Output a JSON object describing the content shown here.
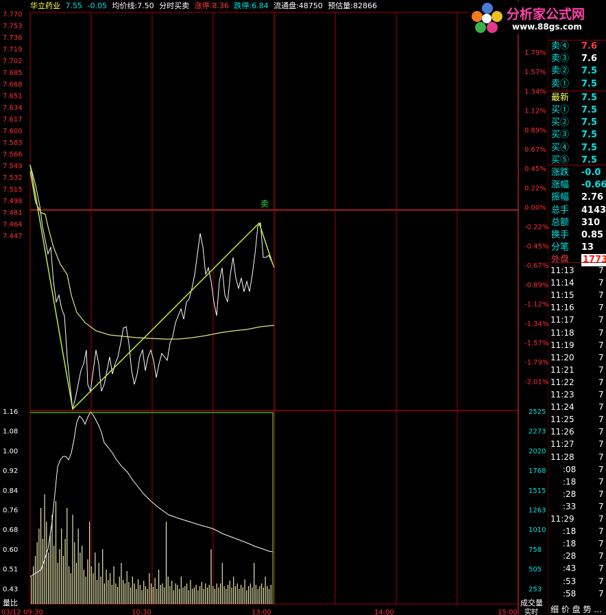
{
  "header": {
    "stock_name": "华立药业",
    "price": "7.55",
    "change": "-0.05",
    "avg_label": "均价线:7.50",
    "chart_mode": "分时买卖",
    "limit_up": "涨停:8.36",
    "limit_down": "跌停:6.84",
    "float_shares": "流通盘:48750",
    "est_volume": "预估量:82866"
  },
  "logo": {
    "name": "分析家公式网",
    "url": "www.88gs.com"
  },
  "price_axis": {
    "left_labels": [
      "7.770",
      "7.753",
      "7.736",
      "7.719",
      "7.702",
      "7.685",
      "7.668",
      "7.651",
      "7.634",
      "7.617",
      "7.600",
      "7.583",
      "7.566",
      "7.549",
      "7.532",
      "7.515",
      "7.498",
      "7.481",
      "7.464",
      "7.447"
    ],
    "right_labels": [
      "1.79%",
      "1.57%",
      "1.34%",
      "1.12%",
      "0.89%",
      "0.67%",
      "0.45%",
      "0.22%",
      "0.00%",
      "-0.22%",
      "-0.45%",
      "-0.67%",
      "-0.89%",
      "-1.12%",
      "-1.34%",
      "-1.57%",
      "-1.79%",
      "-2.01%"
    ]
  },
  "volume_axis": {
    "left_labels": [
      "1.16",
      "1.08",
      "1.00",
      "0.92",
      "0.84",
      "0.76",
      "0.68",
      "0.60",
      "0.51",
      "0.43"
    ],
    "right_labels": [
      "2525",
      "2273",
      "2020",
      "1768",
      "1515",
      "1263",
      "1010",
      "758",
      "505",
      "253"
    ],
    "left_caption": "量比",
    "right_caption": "成交量"
  },
  "signal_label": "卖",
  "time_axis": {
    "date_label": "03/12 09:30",
    "t1": "10:30",
    "t2": "13:00",
    "t3": "14:00",
    "t4": "15:00"
  },
  "bottom": {
    "realtime": "实时",
    "tabs": "细 价 盘 势 ..."
  },
  "quote_panel": {
    "rows": [
      {
        "label": "卖④",
        "value": "7.6",
        "color": "#ff3c3c"
      },
      {
        "label": "卖③",
        "value": "7.6",
        "color": "#ffffff"
      },
      {
        "label": "卖②",
        "value": "7.5",
        "color": "#00e6e6"
      },
      {
        "label": "卖①",
        "value": "7.5",
        "color": "#00e6e6"
      },
      {
        "label": "最新",
        "value": "7.5",
        "color": "#00e6e6"
      },
      {
        "label": "买①",
        "value": "7.5",
        "color": "#00e6e6"
      },
      {
        "label": "买②",
        "value": "7.5",
        "color": "#00e6e6"
      },
      {
        "label": "买③",
        "value": "7.5",
        "color": "#00e6e6"
      },
      {
        "label": "买④",
        "value": "7.5",
        "color": "#00e6e6"
      },
      {
        "label": "买⑤",
        "value": "7.5",
        "color": "#00e6e6"
      },
      {
        "label": "涨跌",
        "value": "-0.0",
        "color": "#00e6e6"
      },
      {
        "label": "涨幅",
        "value": "-0.66",
        "color": "#00e6e6"
      },
      {
        "label": "振幅",
        "value": "2.76",
        "color": "#ffffff"
      },
      {
        "label": "总手",
        "value": "4143",
        "color": "#ffffff"
      },
      {
        "label": "总额",
        "value": "310",
        "color": "#ffffff"
      },
      {
        "label": "换手",
        "value": "0.85",
        "color": "#ffffff"
      },
      {
        "label": "分笔",
        "value": "13",
        "color": "#ffffff"
      },
      {
        "label": "外盘",
        "value": "1773",
        "color": "#ff3c3c"
      }
    ],
    "ticks": [
      {
        "time": "11:13",
        "value": "7"
      },
      {
        "time": "11:14",
        "value": "7"
      },
      {
        "time": "11:15",
        "value": "7"
      },
      {
        "time": "11:16",
        "value": "7"
      },
      {
        "time": "11:17",
        "value": "7"
      },
      {
        "time": "11:18",
        "value": "7"
      },
      {
        "time": "11:19",
        "value": "7"
      },
      {
        "time": "11:20",
        "value": "7"
      },
      {
        "time": "11:21",
        "value": "7"
      },
      {
        "time": "11:22",
        "value": "7"
      },
      {
        "time": "11:23",
        "value": "7"
      },
      {
        "time": "11:24",
        "value": "7"
      },
      {
        "time": "11:25",
        "value": "7"
      },
      {
        "time": "11:26",
        "value": "7"
      },
      {
        "time": "11:27",
        "value": "7"
      },
      {
        "time": "11:28",
        "value": "7"
      },
      {
        "time": ":08",
        "value": "7"
      },
      {
        "time": ":18",
        "value": "7"
      },
      {
        "time": ":28",
        "value": "7"
      },
      {
        "time": ":33",
        "value": "7"
      },
      {
        "time": "11:29",
        "value": "7"
      },
      {
        "time": ":18",
        "value": "7"
      },
      {
        "time": ":18",
        "value": "7"
      },
      {
        "time": ":28",
        "value": "7"
      },
      {
        "time": ":43",
        "value": "7"
      },
      {
        "time": ":53",
        "value": "7"
      },
      {
        "time": ":58",
        "value": "7"
      }
    ]
  },
  "colors": {
    "grid": "#a00000",
    "axis_red": "#ff3030",
    "price_line": "#ffffff",
    "avg_line": "#e6e680",
    "trend_line": "#b8f040",
    "volume_bar": "#e8e8b0",
    "cyan": "#00e6e6"
  }
}
